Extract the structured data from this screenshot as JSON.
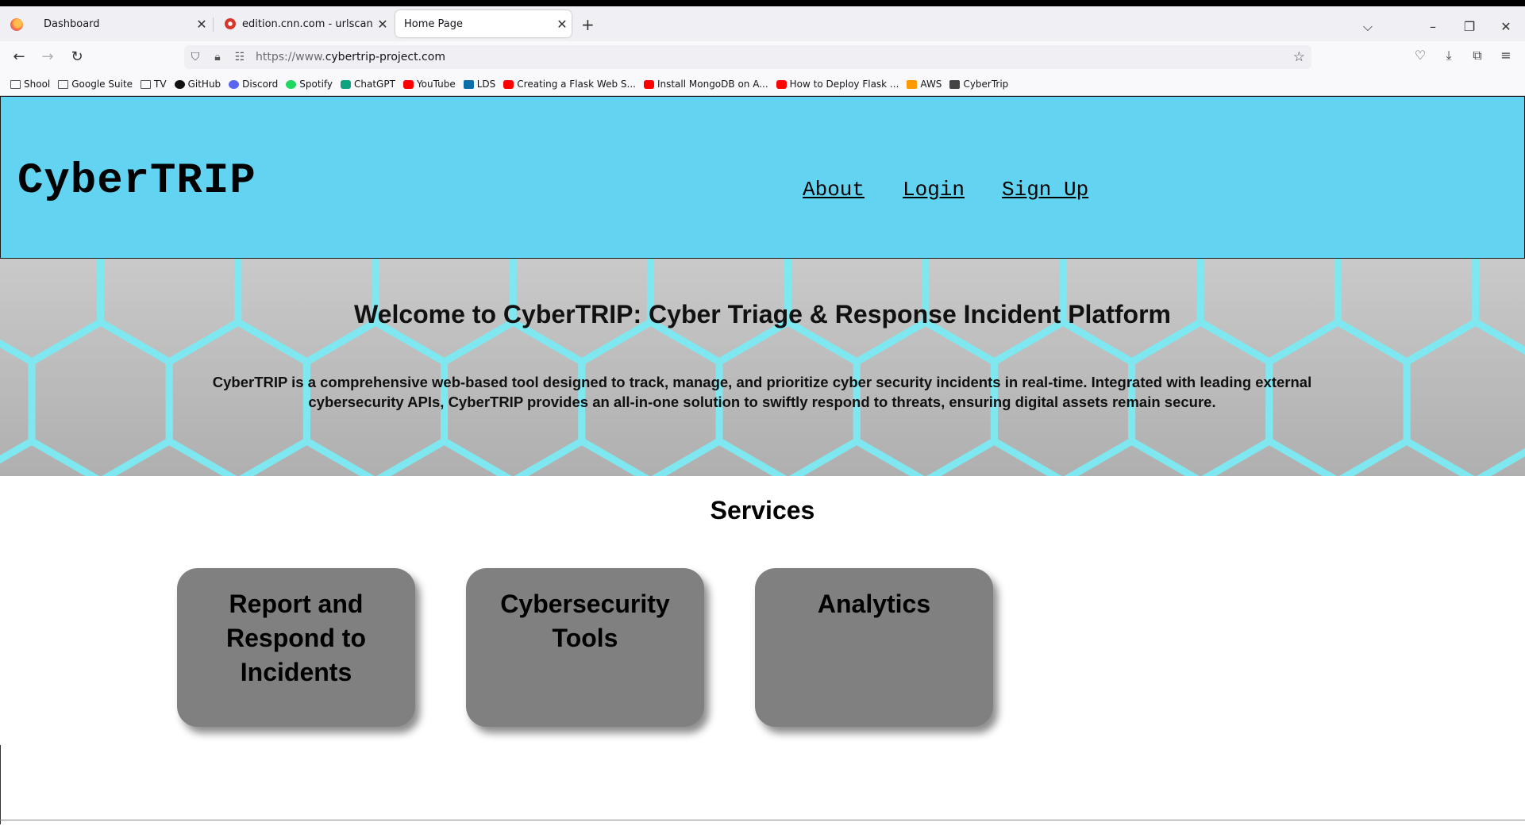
{
  "browser": {
    "tabs": [
      {
        "title": "Dashboard",
        "active": false
      },
      {
        "title": "edition.cnn.com - urlscan.io",
        "active": false
      },
      {
        "title": "Home Page",
        "active": true
      }
    ],
    "new_tab": "+",
    "url_prefix": "https://www.",
    "url_domain": "cybertrip-project.com",
    "bookmarks": [
      {
        "label": "Shool",
        "icon": "folder-icon"
      },
      {
        "label": "Google Suite",
        "icon": "folder-icon"
      },
      {
        "label": "TV",
        "icon": "folder-icon"
      },
      {
        "label": "GitHub",
        "icon": "github-icon"
      },
      {
        "label": "Discord",
        "icon": "discord-icon"
      },
      {
        "label": "Spotify",
        "icon": "spotify-icon"
      },
      {
        "label": "ChatGPT",
        "icon": "chatgpt-icon"
      },
      {
        "label": "YouTube",
        "icon": "youtube-icon"
      },
      {
        "label": "LDS",
        "icon": "lds-icon"
      },
      {
        "label": "Creating a Flask Web S...",
        "icon": "youtube-icon"
      },
      {
        "label": "Install MongoDB on A...",
        "icon": "youtube-icon"
      },
      {
        "label": "How to Deploy Flask ...",
        "icon": "youtube-icon"
      },
      {
        "label": "AWS",
        "icon": "aws-icon"
      },
      {
        "label": "CyberTrip",
        "icon": "cybertrip-icon"
      }
    ]
  },
  "site": {
    "brand": "CyberTRIP",
    "nav": {
      "about": "About",
      "login": "Login",
      "signup": "Sign Up"
    },
    "hero_title": "Welcome to CyberTRIP: Cyber Triage & Response Incident Platform",
    "hero_text_line1": "CyberTRIP is a comprehensive web-based tool designed to track, manage, and prioritize cyber security incidents in real-time. Integrated with leading external",
    "hero_text_line2": "cybersecurity APIs, CyberTRIP provides an all-in-one solution to swiftly respond to threats, ensuring digital assets remain secure.",
    "services_title": "Services",
    "services": [
      {
        "title": "Report and Respond to Incidents"
      },
      {
        "title": "Cybersecurity Tools"
      },
      {
        "title": "Analytics"
      }
    ]
  },
  "colors": {
    "header_bg": "#62d3f1",
    "card_bg": "#808080",
    "hex_glow": "#7fe8f0"
  }
}
